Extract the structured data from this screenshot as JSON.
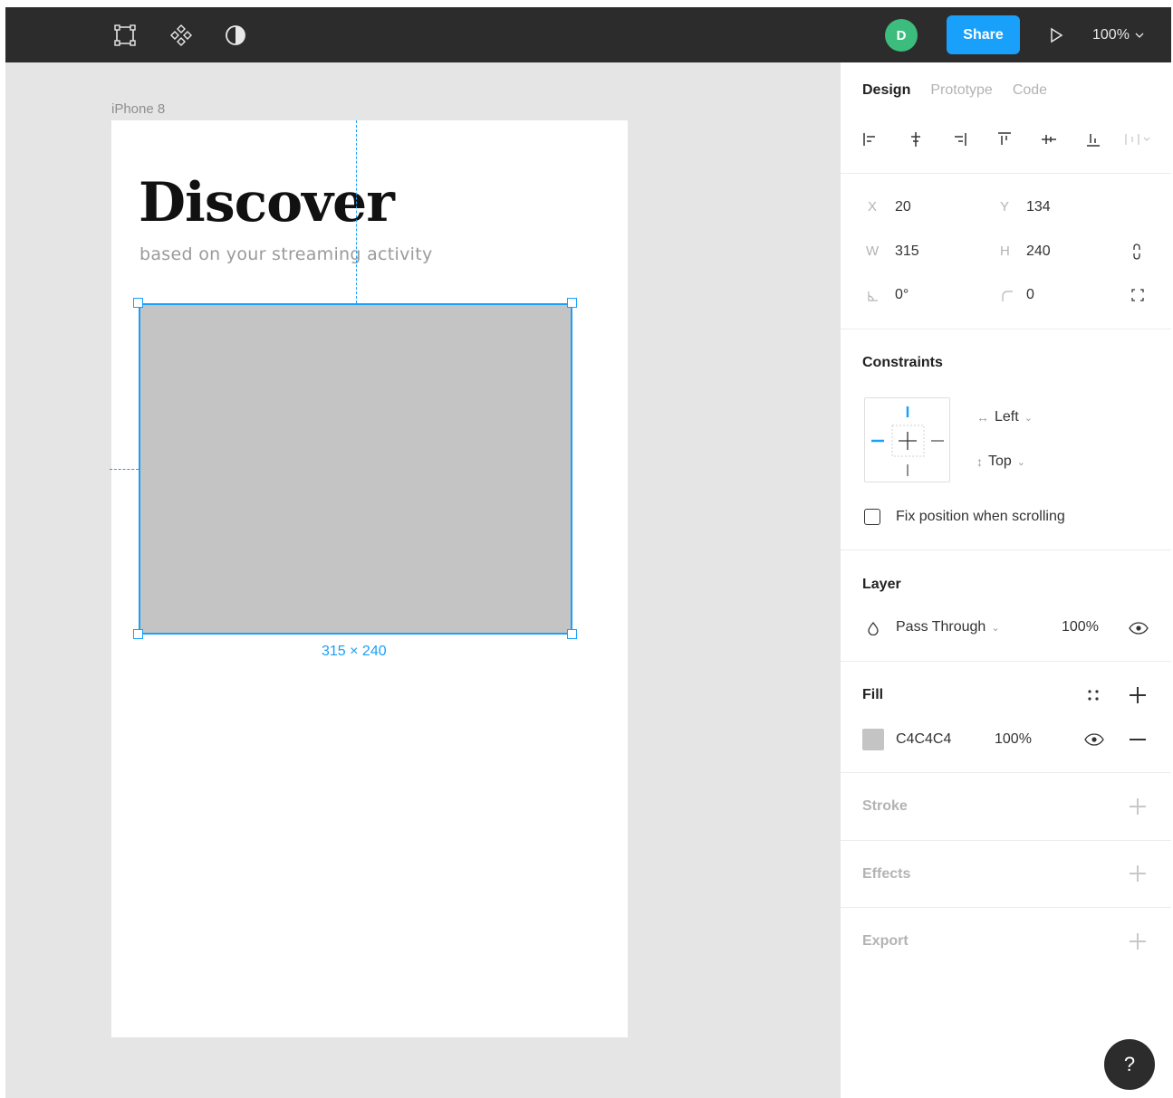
{
  "toolbar": {
    "tools": [
      {
        "name": "frame-tool-icon"
      },
      {
        "name": "component-tool-icon"
      },
      {
        "name": "contrast-mask-icon"
      }
    ],
    "avatar_initial": "D",
    "share_label": "Share",
    "zoom_label": "100%"
  },
  "canvas": {
    "frame_label": "iPhone 8",
    "title": "Discover",
    "subtitle": "based on your streaming activity",
    "selection_dims": "315 × 240",
    "rect_fill": "#c4c4c4",
    "accent": "#18a0fb"
  },
  "panel": {
    "tabs": [
      "Design",
      "Prototype",
      "Code"
    ],
    "active_tab": "Design",
    "props": {
      "x_label": "X",
      "x_value": "20",
      "y_label": "Y",
      "y_value": "134",
      "w_label": "W",
      "w_value": "315",
      "h_label": "H",
      "h_value": "240",
      "rotation_value": "0°",
      "radius_value": "0"
    },
    "constraints": {
      "title": "Constraints",
      "horizontal": "Left",
      "vertical": "Top",
      "fix_position_label": "Fix position when scrolling"
    },
    "layer": {
      "title": "Layer",
      "blend_mode": "Pass Through",
      "opacity": "100%"
    },
    "fill": {
      "title": "Fill",
      "color_hex": "C4C4C4",
      "opacity": "100%"
    },
    "stroke": {
      "title": "Stroke"
    },
    "effects": {
      "title": "Effects"
    },
    "export": {
      "title": "Export"
    }
  },
  "help_label": "?"
}
